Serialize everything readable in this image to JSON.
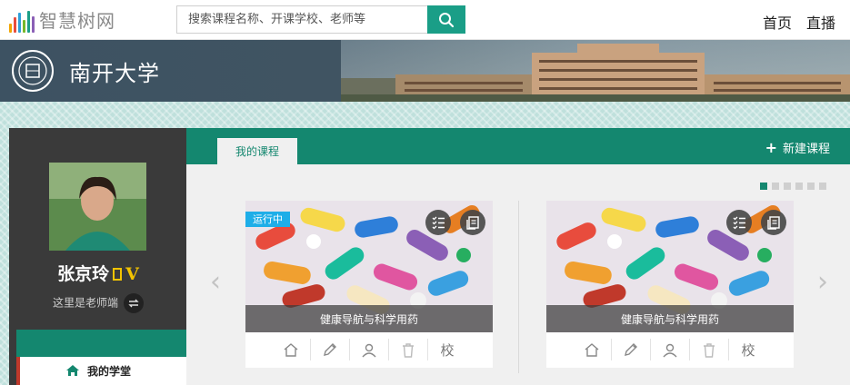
{
  "app": {
    "logo_text": "智慧树网",
    "brand_color": "#1a9e87",
    "logo_bar_colors": [
      "#f2a400",
      "#e84c3d",
      "#2e9fd9",
      "#76b82a",
      "#1a9e87",
      "#8b5fb6"
    ]
  },
  "search": {
    "placeholder": "搜索课程名称、开课学校、老师等",
    "value": "",
    "button_icon": "search-icon"
  },
  "topnav": {
    "items": [
      {
        "label": "首页"
      },
      {
        "label": "直播"
      }
    ]
  },
  "banner": {
    "university_name": "南开大学",
    "seal_icon": "university-seal-icon"
  },
  "profile": {
    "name": "张京玲",
    "badge": "V",
    "role_text": "这里是老师端",
    "switch_icon": "switch-role-icon",
    "nav": [
      {
        "label": "我的学堂",
        "icon": "home-icon",
        "active": true
      }
    ]
  },
  "courses": {
    "tab_label": "我的课程",
    "new_course_label": "新建课程",
    "new_course_icon": "plus-icon",
    "carousel_dots": 6,
    "active_dot": 0,
    "accent": "#14876f",
    "cards": [
      {
        "title": "健康导航与科学用药",
        "status": "运行中",
        "actions": [
          "home-icon",
          "edit-icon",
          "users-icon",
          "trash-icon",
          "校"
        ]
      },
      {
        "title": "健康导航与科学用药",
        "status": "",
        "actions": [
          "home-icon",
          "edit-icon",
          "users-icon",
          "trash-icon",
          "校"
        ]
      }
    ],
    "prev_arrow": "‹",
    "next_arrow": "›"
  }
}
